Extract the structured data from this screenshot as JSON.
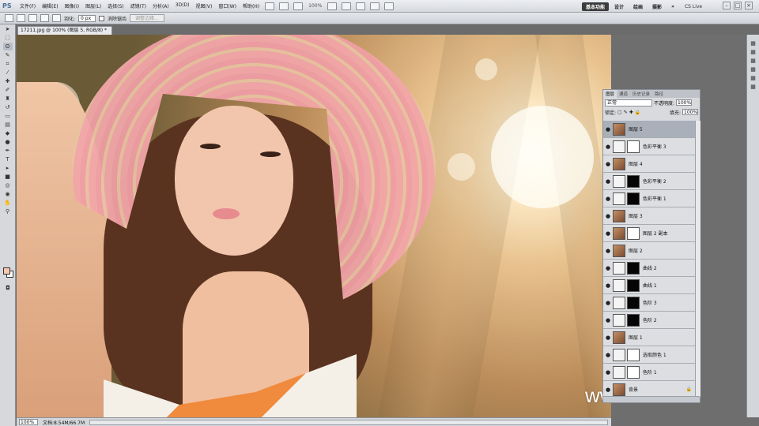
{
  "app": {
    "logo": "PS"
  },
  "menu": [
    "文件(F)",
    "编辑(E)",
    "图像(I)",
    "图层(L)",
    "选择(S)",
    "滤镜(T)",
    "分析(A)",
    "3D(D)",
    "视图(V)",
    "窗口(W)",
    "帮助(H)"
  ],
  "menubar": {
    "zoom": "100%"
  },
  "workspace": {
    "items": [
      "基本功能",
      "设计",
      "绘画",
      "摄影"
    ],
    "active": "基本功能",
    "cs_live": "CS Live"
  },
  "options": {
    "feather_label": "羽化:",
    "feather_value": "0 px",
    "antialias_label": "消除锯齿",
    "refine_edge": "调整边缘..."
  },
  "document": {
    "tab_title": "17211.jpg @ 100% (图层 5, RGB/8) *"
  },
  "status": {
    "zoom": "100%",
    "doc_info": "文档:8.54M/66.7M"
  },
  "watermark": "www.hunis.com",
  "layers_panel": {
    "tabs": [
      "图层",
      "通道",
      "历史记录",
      "路径"
    ],
    "blend_mode": "正常",
    "opacity_label": "不透明度:",
    "opacity": "100%",
    "lock_label": "锁定:",
    "fill_label": "填充:",
    "fill": "100%",
    "layers": [
      {
        "name": "图层 5",
        "thumb": "photo",
        "mask": "none",
        "selected": true
      },
      {
        "name": "色彩平衡 3",
        "thumb": "adj",
        "mask": "white",
        "selected": false
      },
      {
        "name": "图层 4",
        "thumb": "photo",
        "mask": "none",
        "selected": false
      },
      {
        "name": "色彩平衡 2",
        "thumb": "adj",
        "mask": "black",
        "selected": false
      },
      {
        "name": "色彩平衡 1",
        "thumb": "adj",
        "mask": "black",
        "selected": false
      },
      {
        "name": "图层 3",
        "thumb": "photo",
        "mask": "none",
        "selected": false
      },
      {
        "name": "图层 2 副本",
        "thumb": "photo",
        "mask": "white",
        "selected": false
      },
      {
        "name": "图层 2",
        "thumb": "photo",
        "mask": "none",
        "selected": false
      },
      {
        "name": "曲线 2",
        "thumb": "adj",
        "mask": "black",
        "selected": false
      },
      {
        "name": "曲线 1",
        "thumb": "adj",
        "mask": "black",
        "selected": false
      },
      {
        "name": "色阶 3",
        "thumb": "adj",
        "mask": "black",
        "selected": false
      },
      {
        "name": "色阶 2",
        "thumb": "adj",
        "mask": "black",
        "selected": false
      },
      {
        "name": "图层 1",
        "thumb": "photo",
        "mask": "none",
        "selected": false
      },
      {
        "name": "选取颜色 1",
        "thumb": "adj",
        "mask": "white",
        "selected": false
      },
      {
        "name": "色阶 1",
        "thumb": "adj",
        "mask": "white",
        "selected": false
      },
      {
        "name": "背景",
        "thumb": "photo",
        "mask": "none",
        "selected": false,
        "locked": true
      }
    ]
  },
  "colors": {
    "accent": "#3c3c3c",
    "foreground_swatch": "#f6c8b2",
    "background_swatch": "#ffffff"
  }
}
